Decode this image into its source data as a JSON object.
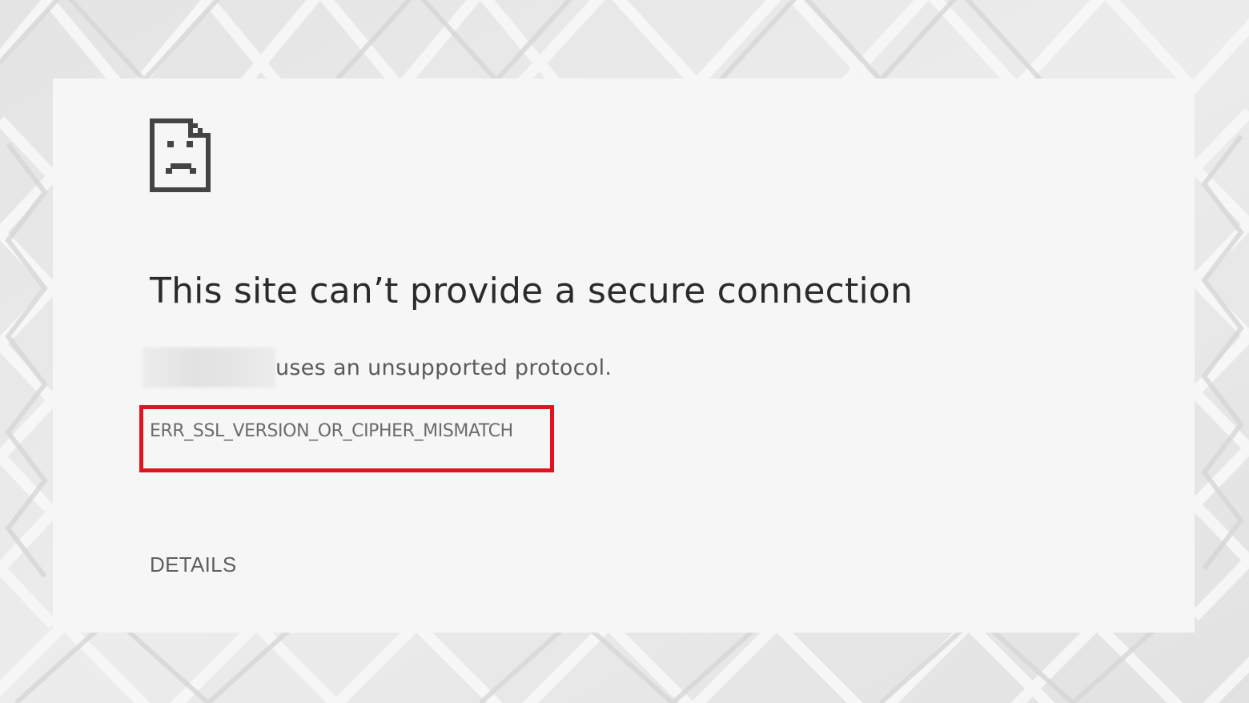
{
  "page": {
    "title": "This site can’t provide a secure connection",
    "subtitle_suffix": "uses an unsupported protocol.",
    "error_code": "ERR_SSL_VERSION_OR_CIPHER_MISMATCH",
    "details_label": "DETAILS"
  },
  "icons": {
    "error_icon": "sad-document-icon"
  },
  "colors": {
    "highlight_border": "#e0141f",
    "card_background": "#f6f6f6",
    "title_text": "#2b2b2b",
    "body_text": "#5a5a5a"
  }
}
